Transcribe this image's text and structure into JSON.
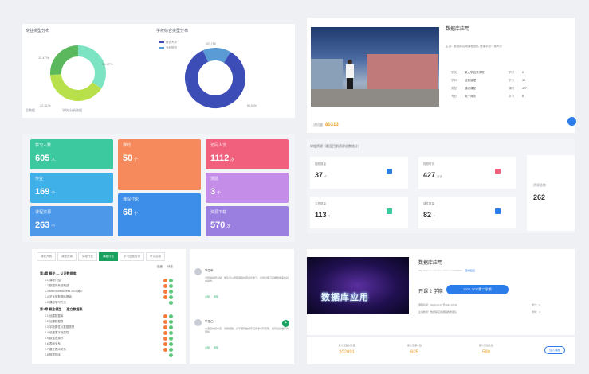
{
  "charts": {
    "left_title": "专业类型分布",
    "right_title": "学校综合类型分布",
    "footer_left": "总数据",
    "footer_right": "学校/分析数据",
    "donut": {
      "labels": [
        "11.47%",
        "59.47%",
        "22.31%"
      ],
      "colors": [
        "#7ce4c3",
        "#b8e04a",
        "#5cb85c"
      ]
    },
    "pie": {
      "legend": [
        "综合大学",
        "专科院校"
      ],
      "labels": [
        "107.788",
        "88.96%"
      ],
      "colors": [
        "#3d4db7",
        "#5b9bd5"
      ]
    }
  },
  "stats": {
    "tiles": [
      {
        "label": "学习人数",
        "value": "605",
        "unit": "人",
        "color": "#3cc9a0"
      },
      {
        "label": "课时",
        "value": "50",
        "unit": "个",
        "color": "#f78a5c"
      },
      {
        "label": "访问人次",
        "value": "1112",
        "unit": "次",
        "color": "#f1617d"
      },
      {
        "label": "作业",
        "value": "169",
        "unit": "个",
        "color": "#3fb0e8"
      },
      {
        "label": "测验",
        "value": "3",
        "unit": "个",
        "color": "#c48de8"
      },
      {
        "label": "课程资源",
        "value": "263",
        "unit": "个",
        "color": "#4d98e8"
      },
      {
        "label": "课程讨论",
        "value": "68",
        "unit": "个",
        "color": "#3d8ee8"
      },
      {
        "label": "资源下载",
        "value": "570",
        "unit": "次",
        "color": "#9a7fe0"
      }
    ]
  },
  "course": {
    "tabs": [
      "课程大纲",
      "课程资源",
      "课程作业",
      "课程讨论",
      "学习进度查询",
      "考试答疑"
    ],
    "active_tab": 3,
    "header": [
      "进度",
      "状态"
    ],
    "chapters": [
      {
        "title": "第1章 概论 — 认识数据库",
        "sections": [
          "1.1 课程介绍",
          "1.2 数据库系统概述",
          "1.3 Microsoft Access 2010简介",
          "1.4 关系型数据库基础",
          "1.5 课程学习方法"
        ]
      },
      {
        "title": "第2章 概念模型 — 建立数据表",
        "sections": [
          "2.1 创建数据库",
          "2.2 创建数据表",
          "2.3 字段属性与数据类型",
          "2.4 设置表字段属性",
          "2.5 数据表操作",
          "2.6 表间关系",
          "2.7 建立表间关系",
          "2.8 数据排序"
        ]
      }
    ]
  },
  "comments": [
    {
      "name": "学生甲",
      "body": "老师讲得很清楚，学生可以按照课程内容逐步学习，并通过练习掌握数据库的基本操作。",
      "like": "点赞",
      "reply": "回复"
    },
    {
      "name": "学生乙",
      "body": "本课程内容丰富，讲解细致，对于理解数据库应用非常有帮助，期待后续章节的更新。",
      "like": "点赞",
      "reply": "回复"
    }
  ],
  "video": {
    "title": "数据库应用",
    "meta": "主讲：数据库应用课程团队   授课学校：某大学",
    "info": [
      [
        "学校",
        "某大学信息学院",
        "学时",
        "8"
      ],
      [
        "学科",
        "信息管理",
        "学分",
        "32"
      ],
      [
        "类型",
        "通识课程",
        "课时",
        "427"
      ],
      [
        "专业",
        "电子商务",
        "章节",
        "8"
      ]
    ],
    "pv_label": "访问量",
    "pv_value": "80313"
  },
  "resources": {
    "title": "课程资源（截至目前资源总数统计）",
    "cards": [
      {
        "label": "视频数量",
        "value": "37",
        "unit": "个",
        "icon_color": "#2b7de9"
      },
      {
        "label": "视频时长",
        "value": "427",
        "unit": "分钟",
        "icon_color": "#f1617d"
      },
      {
        "label": "文档数量",
        "value": "113",
        "unit": "个",
        "icon_color": "#3cc9a0"
      },
      {
        "label": "课件数量",
        "value": "82",
        "unit": "个",
        "icon_color": "#2b7de9"
      }
    ],
    "side_label": "资源总数",
    "side_value": "262"
  },
  "intro": {
    "title": "数据库应用",
    "url": "http://course.example.cn/course/2019001",
    "link": "查看链接",
    "semester": "开课 2 学期",
    "semester_button": "2021-2022第二学期",
    "cover_text": "数据库应用",
    "info": [
      "课程时间：2022-02-07至2022-07-01",
      "主讲教师：数据库应用课程教学团队"
    ],
    "info2": [
      "学分：4",
      "学时：4"
    ],
    "bottom": [
      {
        "label": "累计页面浏览量",
        "value": "202891"
      },
      {
        "label": "累计选课人数",
        "value": "605"
      },
      {
        "label": "累计互动次数",
        "value": "580"
      }
    ],
    "join": "加入课程"
  }
}
